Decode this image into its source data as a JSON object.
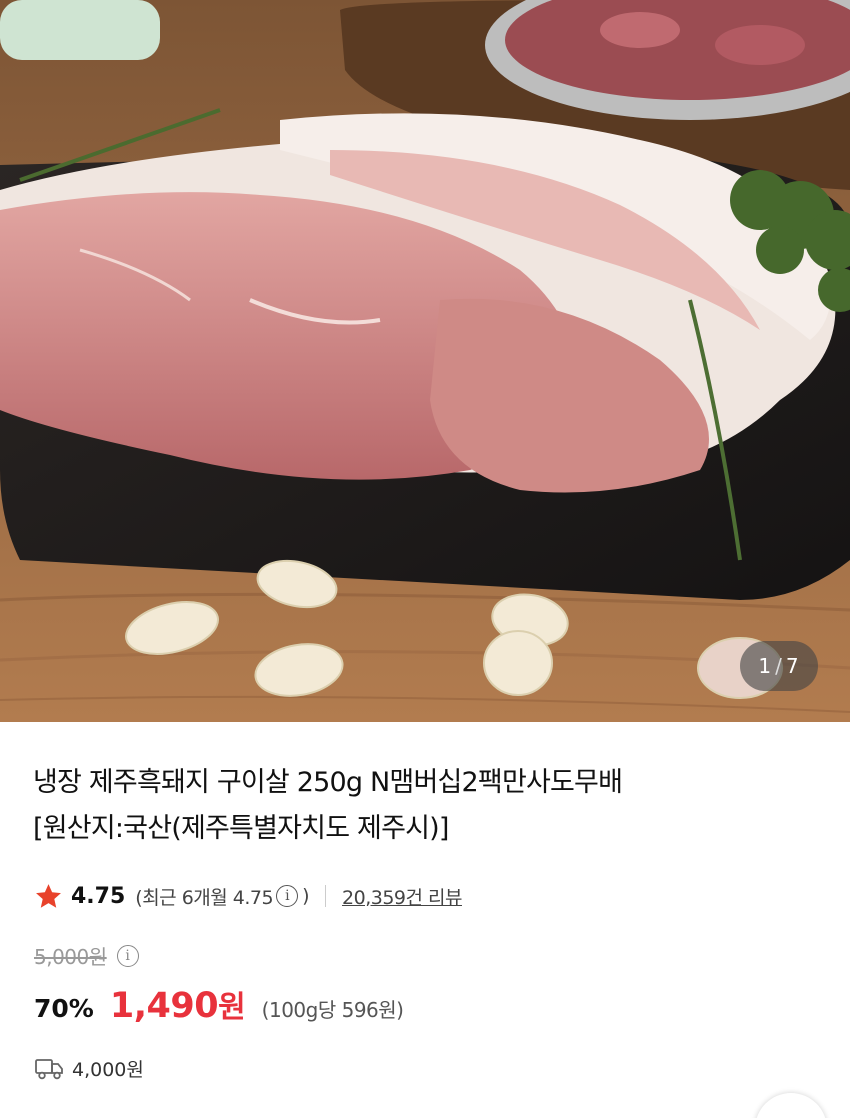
{
  "gallery": {
    "current": "1",
    "separator": "/",
    "total": "7",
    "image_alt": "product-photo-pork-belly"
  },
  "product": {
    "title_line1": "냉장 제주흑돼지 구이살 250g N맴버십2팩만사도무배",
    "title_line2": "[원산지:국산(제주특별자치도 제주시)]"
  },
  "rating": {
    "score": "4.75",
    "recent_prefix": "(최근 6개월 4.75",
    "recent_info": "i",
    "recent_suffix": ")",
    "review_count": "20,359건 리뷰",
    "star_color": "#e8422b"
  },
  "price": {
    "original": "5,000원",
    "original_info": "i",
    "discount": "70%",
    "sale_amount": "1,490",
    "sale_currency": "원",
    "unit_price": "(100g당 596원)",
    "sale_color": "#e8323c"
  },
  "shipping": {
    "icon": "delivery-truck-icon",
    "fee": "4,000원"
  }
}
